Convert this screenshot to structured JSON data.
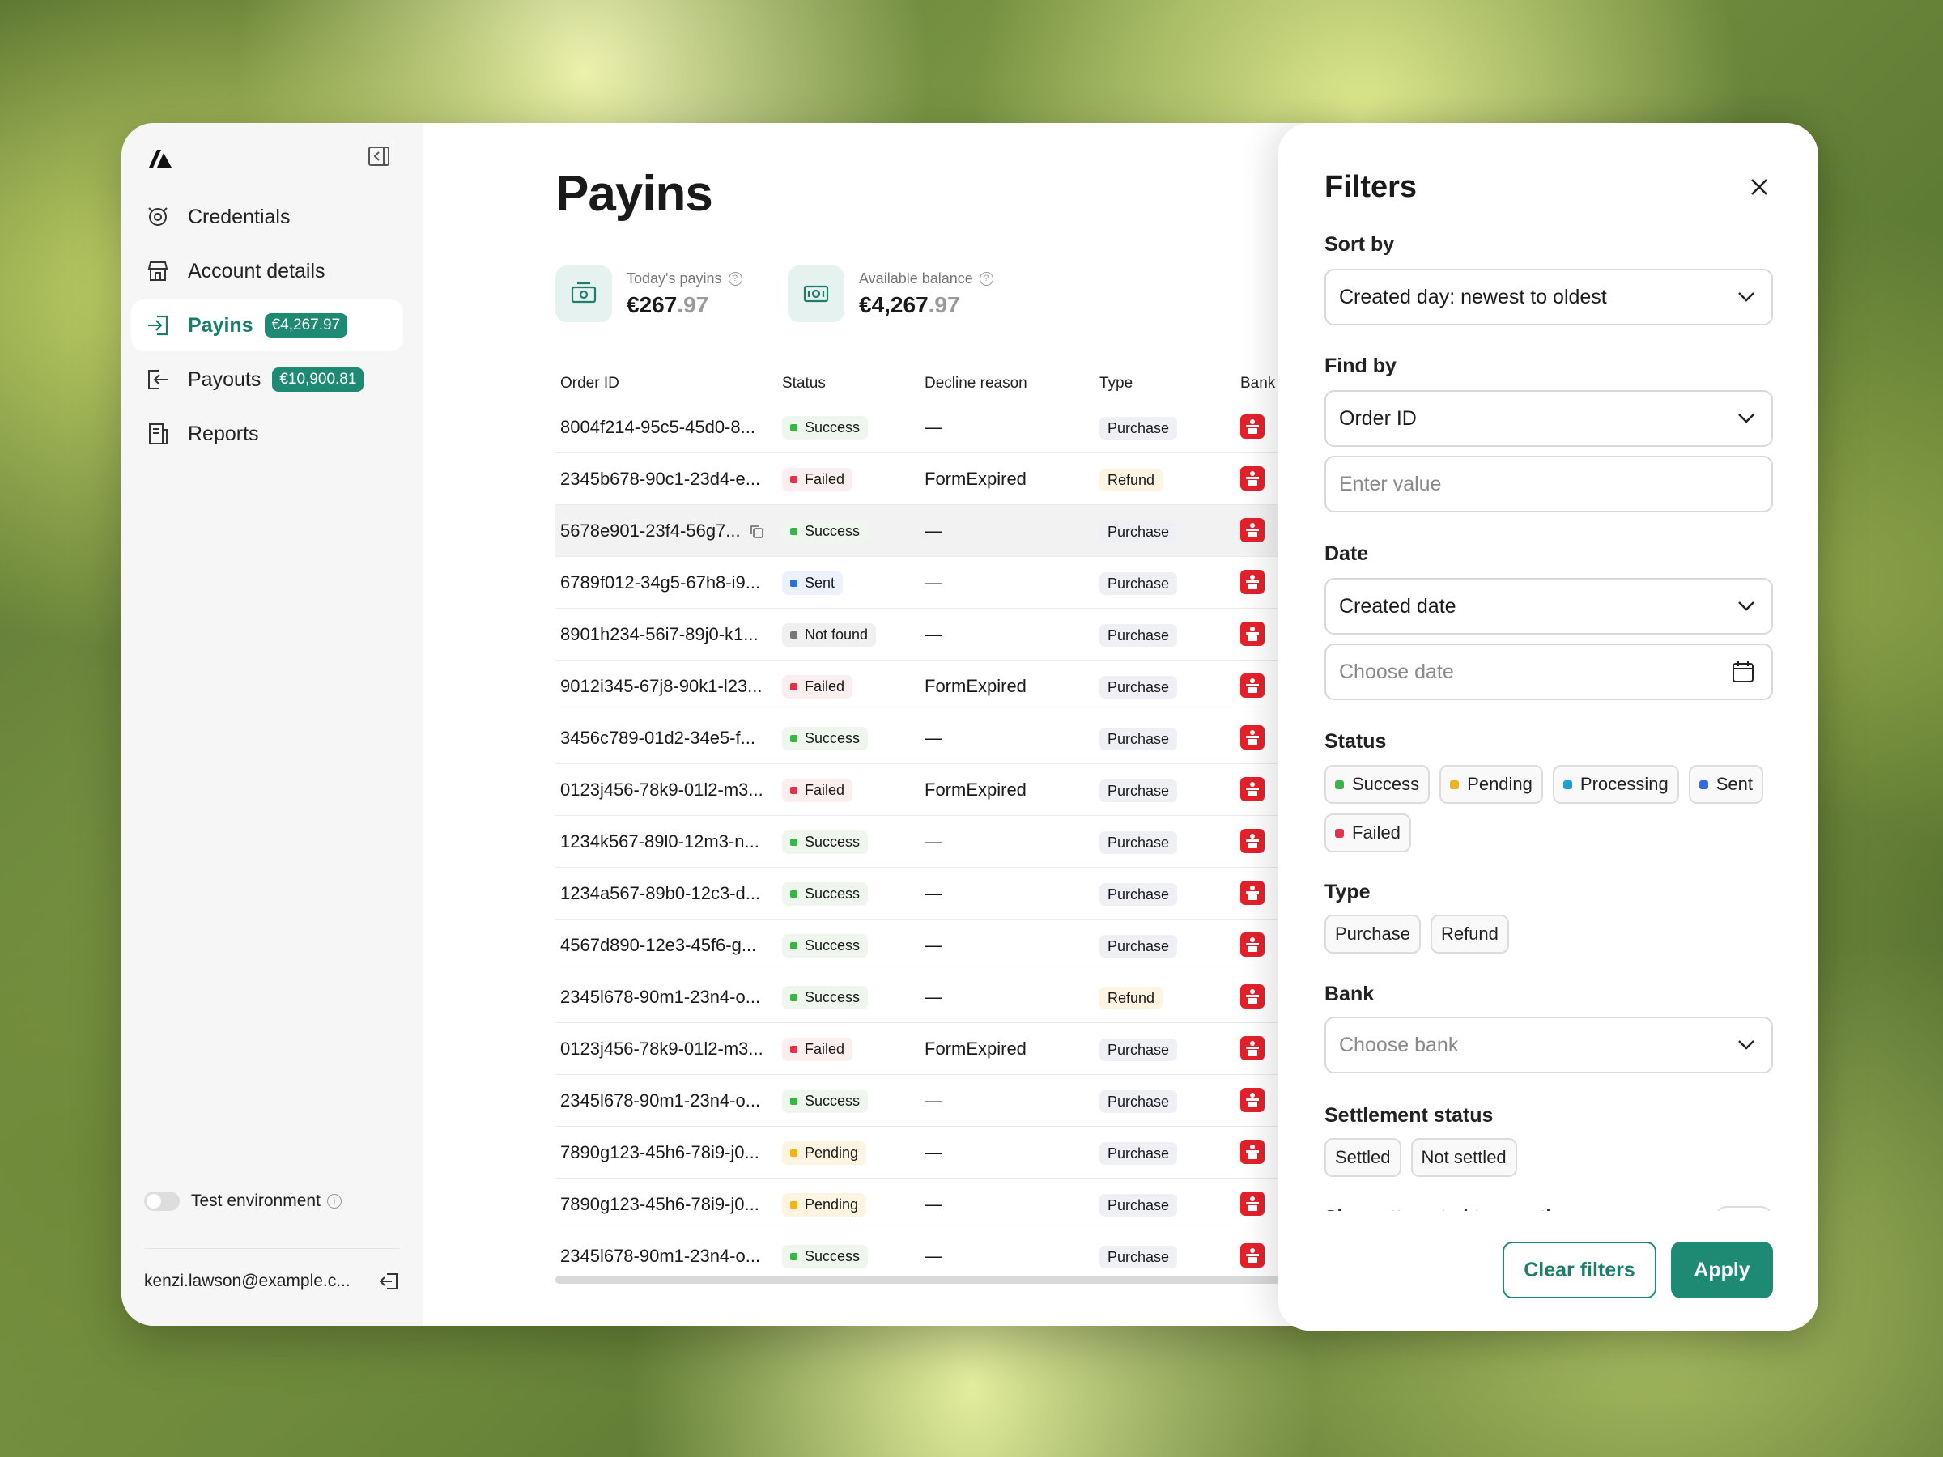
{
  "sidebar": {
    "items": [
      {
        "label": "Credentials",
        "icon": "credentials-icon"
      },
      {
        "label": "Account details",
        "icon": "store-icon"
      },
      {
        "label": "Payins",
        "icon": "payin-icon",
        "badge": "€4,267.97",
        "active": true
      },
      {
        "label": "Payouts",
        "icon": "payout-icon",
        "badge": "€10,900.81"
      },
      {
        "label": "Reports",
        "icon": "reports-icon"
      }
    ],
    "test_env_label": "Test environment",
    "test_env_on": false,
    "user_email": "kenzi.lawson@example.c..."
  },
  "main": {
    "title": "Payins",
    "stats": [
      {
        "label": "Today's payins",
        "value_main": "€267",
        "value_dec": ".97"
      },
      {
        "label": "Available balance",
        "value_main": "€4,267",
        "value_dec": ".97"
      }
    ],
    "columns": [
      "Order ID",
      "Status",
      "Decline reason",
      "Type",
      "Bank"
    ],
    "rows": [
      {
        "id": "8004f214-95c5-45d0-8...",
        "status": "Success",
        "reason": "—",
        "type": "Purchase"
      },
      {
        "id": "2345b678-90c1-23d4-e...",
        "status": "Failed",
        "reason": "FormExpired",
        "type": "Refund"
      },
      {
        "id": "5678e901-23f4-56g7...",
        "status": "Success",
        "reason": "—",
        "type": "Purchase",
        "hover": true
      },
      {
        "id": "6789f012-34g5-67h8-i9...",
        "status": "Sent",
        "reason": "—",
        "type": "Purchase"
      },
      {
        "id": "8901h234-56i7-89j0-k1...",
        "status": "Not found",
        "reason": "—",
        "type": "Purchase"
      },
      {
        "id": "9012i345-67j8-90k1-l23...",
        "status": "Failed",
        "reason": "FormExpired",
        "type": "Purchase"
      },
      {
        "id": "3456c789-01d2-34e5-f...",
        "status": "Success",
        "reason": "—",
        "type": "Purchase"
      },
      {
        "id": "0123j456-78k9-01l2-m3...",
        "status": "Failed",
        "reason": "FormExpired",
        "type": "Purchase"
      },
      {
        "id": "1234k567-89l0-12m3-n...",
        "status": "Success",
        "reason": "—",
        "type": "Purchase"
      },
      {
        "id": "1234a567-89b0-12c3-d...",
        "status": "Success",
        "reason": "—",
        "type": "Purchase"
      },
      {
        "id": "4567d890-12e3-45f6-g...",
        "status": "Success",
        "reason": "—",
        "type": "Purchase"
      },
      {
        "id": "2345l678-90m1-23n4-o...",
        "status": "Success",
        "reason": "—",
        "type": "Refund"
      },
      {
        "id": "0123j456-78k9-01l2-m3...",
        "status": "Failed",
        "reason": "FormExpired",
        "type": "Purchase"
      },
      {
        "id": "2345l678-90m1-23n4-o...",
        "status": "Success",
        "reason": "—",
        "type": "Purchase"
      },
      {
        "id": "7890g123-45h6-78i9-j0...",
        "status": "Pending",
        "reason": "—",
        "type": "Purchase"
      },
      {
        "id": "7890g123-45h6-78i9-j0...",
        "status": "Pending",
        "reason": "—",
        "type": "Purchase"
      },
      {
        "id": "2345l678-90m1-23n4-o...",
        "status": "Success",
        "reason": "—",
        "type": "Purchase"
      }
    ]
  },
  "filters": {
    "title": "Filters",
    "sort_by_label": "Sort by",
    "sort_by_value": "Created day: newest to oldest",
    "find_by_label": "Find by",
    "find_by_value": "Order ID",
    "value_placeholder": "Enter value",
    "date_label": "Date",
    "date_value": "Created date",
    "date_placeholder": "Choose date",
    "status_label": "Status",
    "status_options": [
      {
        "label": "Success",
        "color": "#39b54a"
      },
      {
        "label": "Pending",
        "color": "#f2b21a"
      },
      {
        "label": "Processing",
        "color": "#1b9fd6"
      },
      {
        "label": "Sent",
        "color": "#2d6fe0"
      },
      {
        "label": "Failed",
        "color": "#e0344a"
      }
    ],
    "type_label": "Type",
    "type_options": [
      "Purchase",
      "Refund"
    ],
    "bank_label": "Bank",
    "bank_placeholder": "Choose bank",
    "settlement_label": "Settlement status",
    "settlement_options": [
      "Settled",
      "Not settled"
    ],
    "attempted_label": "Show attempted transactions",
    "clear_label": "Clear filters",
    "apply_label": "Apply"
  },
  "colors": {
    "accent": "#1f8a74",
    "bank": "#e3212b"
  }
}
